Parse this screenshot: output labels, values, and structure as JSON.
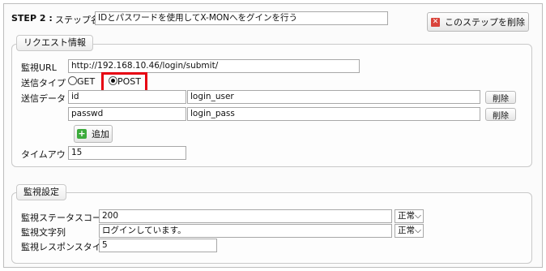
{
  "step": {
    "label": "STEP 2 :",
    "name_label": "ステップ名称",
    "name_value": "IDとパスワードを使用してX-MONへをグインを行う",
    "delete_button": "このステップを削除"
  },
  "request": {
    "legend": "リクエスト情報",
    "url_label": "監視URL",
    "url_value": "http://192.168.10.46/login/submit/",
    "send_type_label": "送信タイプ",
    "radio_get": "GET",
    "radio_post": "POST",
    "selected_type": "POST",
    "send_data_label": "送信データ",
    "rows": [
      {
        "key": "id",
        "value": "login_user",
        "delete": "削除"
      },
      {
        "key": "passwd",
        "value": "login_pass",
        "delete": "削除"
      }
    ],
    "add_button": "追加",
    "timeout_label": "タイムアウト",
    "timeout_value": "15"
  },
  "monitor": {
    "legend": "監視設定",
    "status_code_label": "監視ステータスコード",
    "status_code_value": "200",
    "status_code_select": "正常",
    "string_label": "監視文字列",
    "string_value": "ログインしています。",
    "string_select": "正常",
    "response_time_label": "監視レスポンスタイム",
    "response_time_value": "5"
  },
  "colors": {
    "highlight": "#e60012",
    "delete_icon": "#d9433a",
    "add_icon": "#3cab3c"
  },
  "icons": {
    "delete_step": "delete-icon",
    "add": "add-icon",
    "select_caret": "chevron-down-icon"
  }
}
